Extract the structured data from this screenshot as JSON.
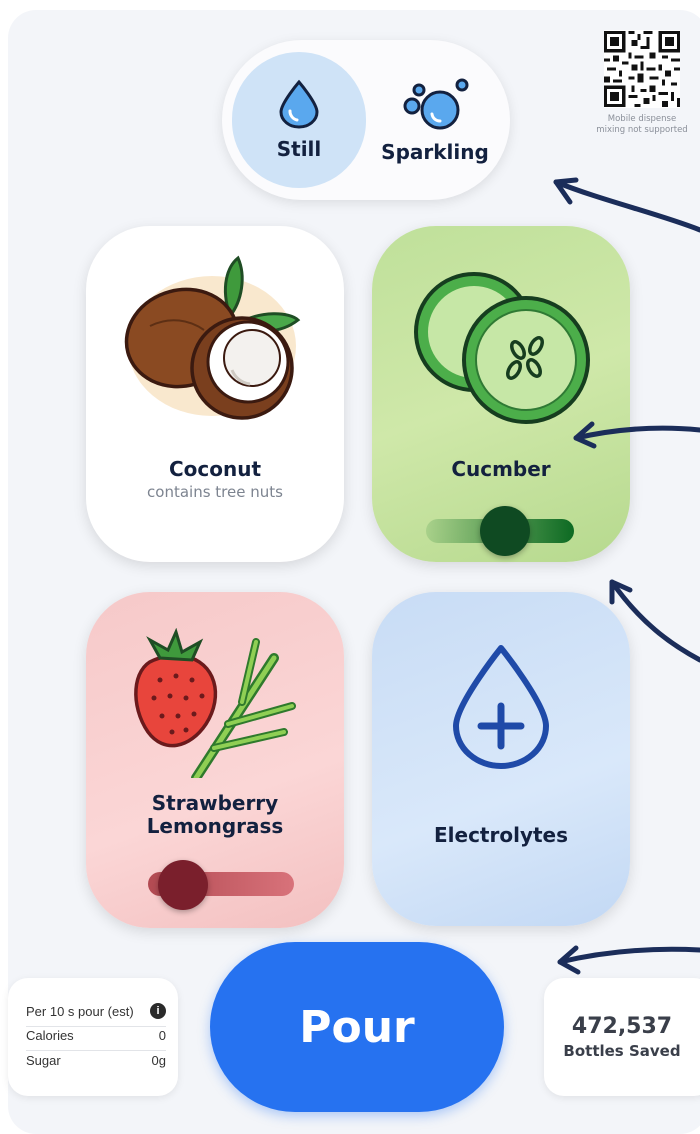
{
  "water_type": {
    "options": [
      {
        "label": "Still",
        "selected": true
      },
      {
        "label": "Sparkling",
        "selected": false
      }
    ]
  },
  "qr": {
    "caption_line1": "Mobile dispense",
    "caption_line2": "mixing not supported"
  },
  "flavors": {
    "coconut": {
      "name": "Coconut",
      "note": "contains tree nuts"
    },
    "cucumber": {
      "name": "Cucmber",
      "intensity": 0.55
    },
    "strawberry": {
      "name_line1": "Strawberry",
      "name_line2": "Lemongrass",
      "intensity": 0.1
    },
    "electrolytes": {
      "name": "Electrolytes"
    }
  },
  "pour": {
    "label": "Pour"
  },
  "nutrition": {
    "header": "Per 10 s pour (est)",
    "rows": [
      {
        "label": "Calories",
        "value": "0"
      },
      {
        "label": "Sugar",
        "value": "0g"
      }
    ]
  },
  "stats": {
    "count": "472,537",
    "label": "Bottles Saved"
  },
  "colors": {
    "accent": "#2672f0",
    "still_selected": "#cfe3f7",
    "cucumber_slider": "#0f5a24",
    "strawberry_slider": "#8a2030",
    "annotation_arrow": "#1b2d5a"
  }
}
